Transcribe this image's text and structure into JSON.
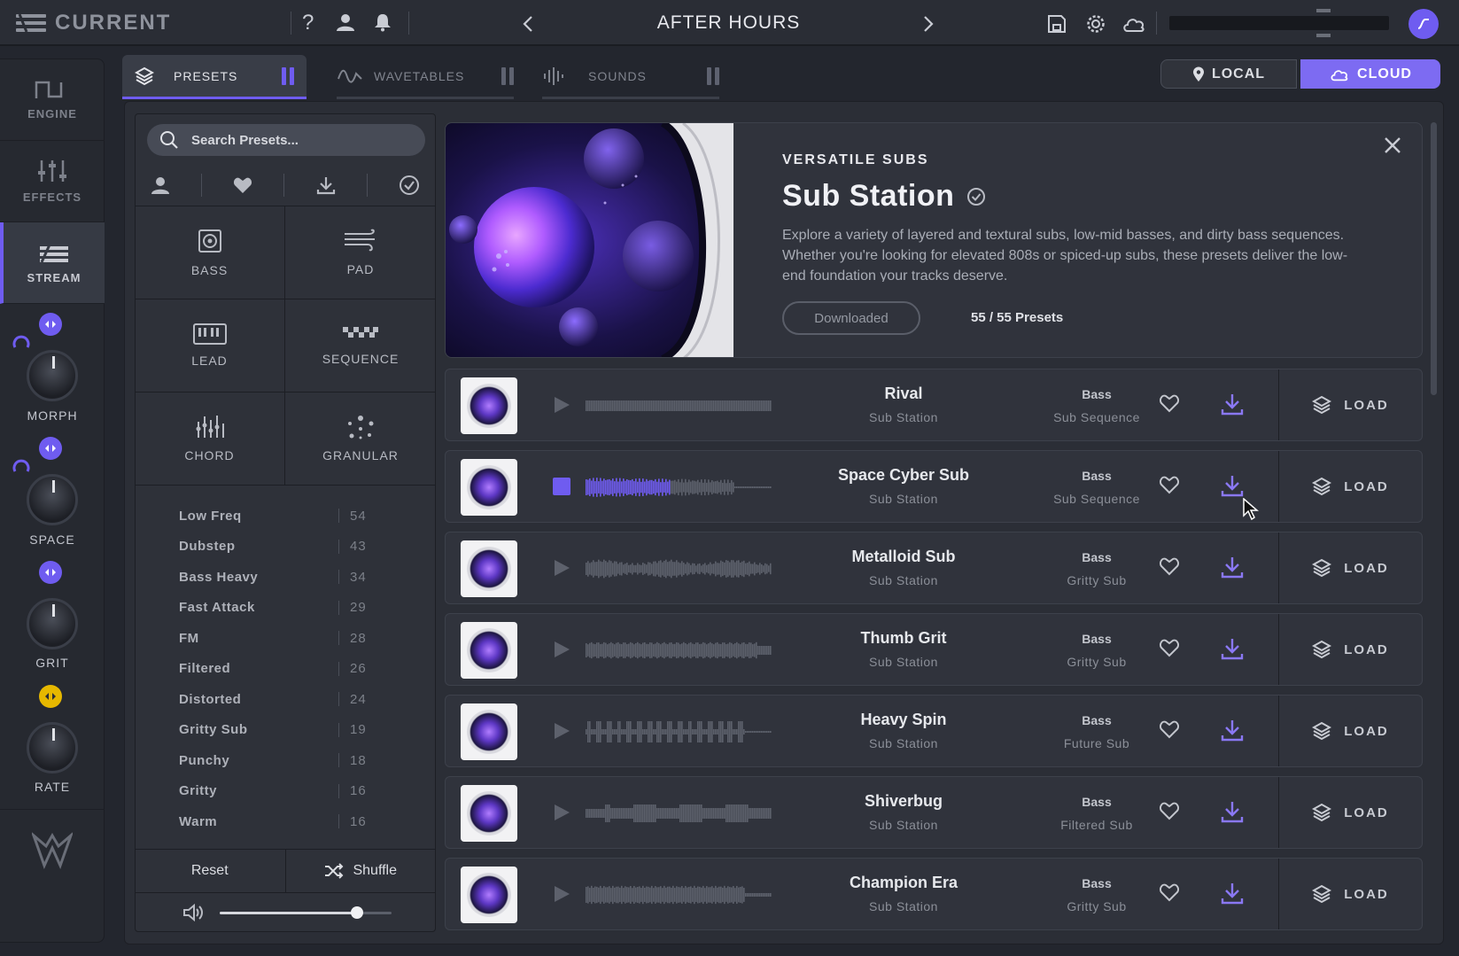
{
  "app": {
    "brand": "CURRENT",
    "preset_title": "AFTER HOURS",
    "accent": "#6f5cf0"
  },
  "header_icons": [
    "menu-icon",
    "help-icon",
    "user-icon",
    "bell-icon",
    "save-icon",
    "gear-icon",
    "cloud-icon"
  ],
  "help_glyph": "?",
  "rail": {
    "items": [
      {
        "label": "ENGINE",
        "icon": "engine-icon"
      },
      {
        "label": "EFFECTS",
        "icon": "sliders-icon"
      },
      {
        "label": "STREAM",
        "icon": "stream-icon",
        "active": true
      }
    ],
    "knobs": [
      {
        "label": "MORPH",
        "mod_color": "#6f5cf0"
      },
      {
        "label": "SPACE",
        "mod_color": "#6f5cf0"
      },
      {
        "label": "GRIT",
        "mod_color": "#6f5cf0"
      },
      {
        "label": "RATE",
        "mod_color": "#e6b800"
      }
    ]
  },
  "tabs": [
    {
      "label": "PRESETS",
      "active": true
    },
    {
      "label": "WAVETABLES"
    },
    {
      "label": "SOUNDS"
    }
  ],
  "location": {
    "local": "LOCAL",
    "cloud": "CLOUD",
    "selected": "CLOUD"
  },
  "browser": {
    "search_placeholder": "Search Presets...",
    "filter_icons": [
      "user-icon",
      "heart-icon",
      "download-icon",
      "check-circle-icon"
    ],
    "categories": [
      {
        "label": "BASS",
        "icon": "bass-icon"
      },
      {
        "label": "PAD",
        "icon": "pad-icon"
      },
      {
        "label": "LEAD",
        "icon": "lead-icon"
      },
      {
        "label": "SEQUENCE",
        "icon": "sequence-icon"
      },
      {
        "label": "CHORD",
        "icon": "chord-icon"
      },
      {
        "label": "GRANULAR",
        "icon": "granular-icon"
      }
    ],
    "tags": [
      {
        "name": "Low Freq",
        "count": "54"
      },
      {
        "name": "Dubstep",
        "count": "43"
      },
      {
        "name": "Bass Heavy",
        "count": "34"
      },
      {
        "name": "Fast Attack",
        "count": "29"
      },
      {
        "name": "FM",
        "count": "28"
      },
      {
        "name": "Filtered",
        "count": "26"
      },
      {
        "name": "Distorted",
        "count": "24"
      },
      {
        "name": "Gritty Sub",
        "count": "19"
      },
      {
        "name": "Punchy",
        "count": "18"
      },
      {
        "name": "Gritty",
        "count": "16"
      },
      {
        "name": "Warm",
        "count": "16"
      }
    ],
    "reset_label": "Reset",
    "shuffle_label": "Shuffle",
    "volume": 0.8
  },
  "pack": {
    "category": "VERSATILE SUBS",
    "title": "Sub Station",
    "description": "Explore a variety of layered and textural subs, low-mid basses, and dirty bass sequences. Whether you're looking for elevated 808s or spiced-up subs, these presets deliver the low-end foundation your tracks deserve.",
    "status_button": "Downloaded",
    "count": "55 / 55 Presets"
  },
  "load_label": "LOAD",
  "presets": [
    {
      "name": "Rival",
      "pack": "Sub Station",
      "type": "Bass",
      "subtype": "Sub Sequence",
      "playing": false,
      "wave": "flat"
    },
    {
      "name": "Space Cyber Sub",
      "pack": "Sub Station",
      "type": "Bass",
      "subtype": "Sub Sequence",
      "playing": true,
      "wave": "decay"
    },
    {
      "name": "Metalloid Sub",
      "pack": "Sub Station",
      "type": "Bass",
      "subtype": "Gritty Sub",
      "playing": false,
      "wave": "swell"
    },
    {
      "name": "Thumb Grit",
      "pack": "Sub Station",
      "type": "Bass",
      "subtype": "Gritty Sub",
      "playing": false,
      "wave": "dense"
    },
    {
      "name": "Heavy Spin",
      "pack": "Sub Station",
      "type": "Bass",
      "subtype": "Future Sub",
      "playing": false,
      "wave": "pulses"
    },
    {
      "name": "Shiverbug",
      "pack": "Sub Station",
      "type": "Bass",
      "subtype": "Filtered Sub",
      "playing": false,
      "wave": "blocks"
    },
    {
      "name": "Champion Era",
      "pack": "Sub Station",
      "type": "Bass",
      "subtype": "Gritty Sub",
      "playing": false,
      "wave": "tail"
    }
  ]
}
